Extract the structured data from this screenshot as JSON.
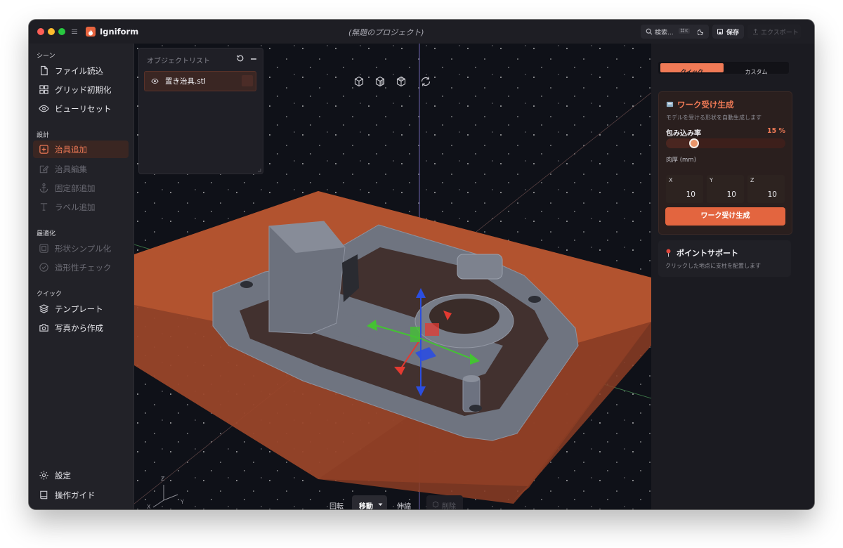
{
  "app": {
    "name": "Igniform",
    "project_title": "(無題のプロジェクト)"
  },
  "toolbar": {
    "search_label": "検索...",
    "search_shortcut": "⌘K",
    "save_label": "保存",
    "export_label": "エクスポート"
  },
  "sidebar": {
    "sections": [
      {
        "title": "シーン",
        "items": [
          {
            "label": "ファイル読込",
            "icon": "file-icon",
            "state": "normal"
          },
          {
            "label": "グリッド初期化",
            "icon": "grid-icon",
            "state": "normal"
          },
          {
            "label": "ビューリセット",
            "icon": "eye-icon",
            "state": "normal"
          }
        ]
      },
      {
        "title": "設計",
        "items": [
          {
            "label": "治具追加",
            "icon": "plus-square-icon",
            "state": "active"
          },
          {
            "label": "治具編集",
            "icon": "edit-icon",
            "state": "disabled"
          },
          {
            "label": "固定部追加",
            "icon": "anchor-icon",
            "state": "disabled"
          },
          {
            "label": "ラベル追加",
            "icon": "text-icon",
            "state": "disabled"
          }
        ]
      },
      {
        "title": "最適化",
        "items": [
          {
            "label": "形状シンプル化",
            "icon": "simplify-icon",
            "state": "disabled"
          },
          {
            "label": "造形性チェック",
            "icon": "check-circle-icon",
            "state": "disabled"
          }
        ]
      },
      {
        "title": "クイック",
        "items": [
          {
            "label": "テンプレート",
            "icon": "layers-icon",
            "state": "normal"
          },
          {
            "label": "写真から作成",
            "icon": "camera-icon",
            "state": "normal"
          }
        ]
      }
    ],
    "footer": [
      {
        "label": "設定",
        "icon": "gear-icon"
      },
      {
        "label": "操作ガイド",
        "icon": "book-icon"
      }
    ]
  },
  "object_list": {
    "title": "オブジェクトリスト",
    "items": [
      {
        "name": "置き治具.stl",
        "visible": true
      }
    ]
  },
  "view_controls": [
    "cube-front-icon",
    "cube-side-icon",
    "cube-top-icon",
    "rotate-view-icon"
  ],
  "transform_bar": {
    "rotate": "回転",
    "move": "移動",
    "scale": "伸縮",
    "delete": "削除"
  },
  "axis_labels": {
    "z": "Z",
    "x": "X",
    "y": "Y"
  },
  "right_panel": {
    "tabs": {
      "quick": "クイック",
      "custom": "カスタム",
      "active": "quick"
    },
    "work_receiver": {
      "title": "ワーク受け生成",
      "subtitle": "モデルを受ける形状を自動生成します",
      "wrap_label": "包み込み率",
      "wrap_value_text": "15 %",
      "wrap_value": 15,
      "thickness_label": "肉厚 (mm)",
      "x_label": "X",
      "x_value": "10",
      "y_label": "Y",
      "y_value": "10",
      "z_label": "Z",
      "z_value": "10",
      "button": "ワーク受け生成"
    },
    "point_support": {
      "title": "ポイントサポート",
      "subtitle": "クリックした地点に支柱を配置します"
    }
  },
  "colors": {
    "accent": "#e8643f",
    "window_bg": "#1b1b21",
    "viewport_bg": "#0f1118",
    "base_plate": "#b4542f",
    "part": "#6f7480"
  }
}
